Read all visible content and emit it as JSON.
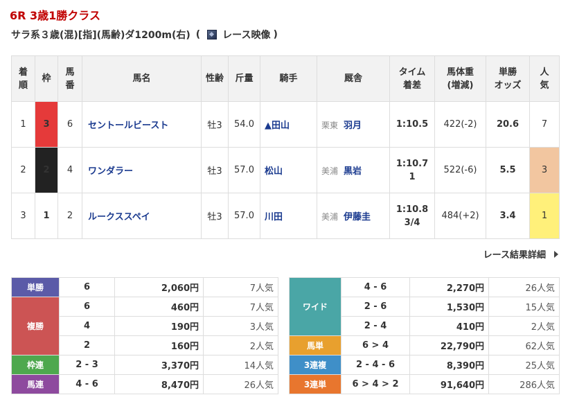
{
  "race": {
    "title": "6R 3歳1勝クラス",
    "info": "サラ系３歳(混)[指](馬齢)ダ1200m(右)",
    "video_open": "(",
    "video_label": "レース映像",
    "video_close": ")"
  },
  "headers": {
    "rank": [
      "着",
      "順"
    ],
    "waku": "枠",
    "umaban": [
      "馬",
      "番"
    ],
    "horse": "馬名",
    "sexage": "性齢",
    "weight": "斤量",
    "jockey": "騎手",
    "trainer": "厩舎",
    "time": [
      "タイム",
      "着差"
    ],
    "body": [
      "馬体重",
      "(増減)"
    ],
    "odds": [
      "単勝",
      "オッズ"
    ],
    "pop": [
      "人",
      "気"
    ]
  },
  "results": [
    {
      "rank": "1",
      "waku": "3",
      "umaban": "6",
      "horse": "セントールビースト",
      "sexage": "牡3",
      "weight": "54.0",
      "jockey": "▲田山",
      "region": "栗東",
      "trainer": "羽月",
      "time1": "1:10.5",
      "time2": "",
      "body": "422(-2)",
      "odds": "20.6",
      "pop": "7"
    },
    {
      "rank": "2",
      "waku": "2",
      "umaban": "4",
      "horse": "ワンダラー",
      "sexage": "牡3",
      "weight": "57.0",
      "jockey": "松山",
      "region": "美浦",
      "trainer": "黒岩",
      "time1": "1:10.7",
      "time2": "1",
      "body": "522(-6)",
      "odds": "5.5",
      "pop": "3"
    },
    {
      "rank": "3",
      "waku": "1",
      "umaban": "2",
      "horse": "ルークススペイ",
      "sexage": "牡3",
      "weight": "57.0",
      "jockey": "川田",
      "region": "美浦",
      "trainer": "伊藤圭",
      "time1": "1:10.8",
      "time2": "3/4",
      "body": "484(+2)",
      "odds": "3.4",
      "pop": "1"
    }
  ],
  "detail_link": "レース結果詳細",
  "payouts_left": {
    "tansho": {
      "label": "単勝",
      "combo": "6",
      "amount": "2,060円",
      "pop": "7人気"
    },
    "fukusho": {
      "label": "複勝",
      "rows": [
        {
          "combo": "6",
          "amount": "460円",
          "pop": "7人気"
        },
        {
          "combo": "4",
          "amount": "190円",
          "pop": "3人気"
        },
        {
          "combo": "2",
          "amount": "160円",
          "pop": "2人気"
        }
      ]
    },
    "wakuren": {
      "label": "枠連",
      "combo": "2 - 3",
      "amount": "3,370円",
      "pop": "14人気"
    },
    "umaren": {
      "label": "馬連",
      "combo": "4 - 6",
      "amount": "8,470円",
      "pop": "26人気"
    }
  },
  "payouts_right": {
    "wide": {
      "label": "ワイド",
      "rows": [
        {
          "combo": "4 - 6",
          "amount": "2,270円",
          "pop": "26人気"
        },
        {
          "combo": "2 - 6",
          "amount": "1,530円",
          "pop": "15人気"
        },
        {
          "combo": "2 - 4",
          "amount": "410円",
          "pop": "2人気"
        }
      ]
    },
    "umatan": {
      "label": "馬単",
      "combo": "6 > 4",
      "amount": "22,790円",
      "pop": "62人気"
    },
    "sanrenpuku": {
      "label": "3連複",
      "combo": "2 - 4 - 6",
      "amount": "8,390円",
      "pop": "25人気"
    },
    "sanrentan": {
      "label": "3連単",
      "combo": "6 > 4 > 2",
      "amount": "91,640円",
      "pop": "286人気"
    }
  },
  "colors": {
    "tansho": "#5b5ba8",
    "fukusho": "#cc5454",
    "wakuren": "#4ea84e",
    "umaren": "#8e4a9e",
    "wide": "#4aa6a6",
    "umatan": "#e8a02e",
    "sanrenpuku": "#3f8fc8",
    "sanrentan": "#e8762e"
  }
}
